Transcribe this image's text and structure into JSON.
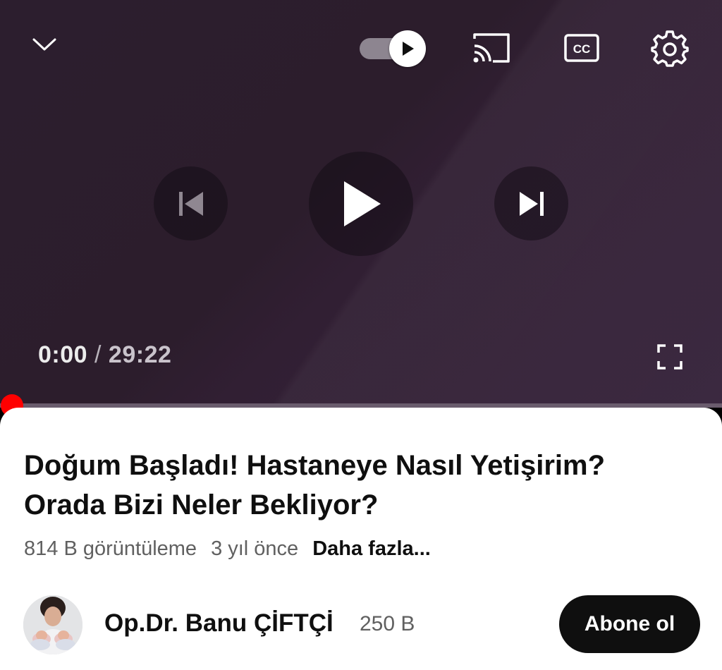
{
  "player": {
    "icons": {
      "collapse": "chevron-down-icon",
      "autoplay": "autoplay-toggle-icon",
      "cast": "cast-icon",
      "captions": "closed-captions-icon",
      "settings": "gear-icon",
      "previous": "skip-previous-icon",
      "play": "play-icon",
      "next": "skip-next-icon",
      "fullscreen": "fullscreen-icon"
    },
    "current_time": "0:00",
    "separator": "/",
    "duration": "29:22",
    "cc_label": "CC",
    "progress": 0,
    "autoplay_on": true,
    "colors": {
      "background": "#2c1e2e",
      "progress_track": "#6a5c6d",
      "scrubber": "#ff0000"
    }
  },
  "video": {
    "title": "Doğum Başladı! Hastaneye Nasıl Yetişirim? Orada Bizi Neler Bekliyor?",
    "views": "814 B görüntüleme",
    "age": "3 yıl önce",
    "more_label": "Daha fazla..."
  },
  "channel": {
    "name": "Op.Dr. Banu ÇİFTÇİ",
    "subscribers": "250 B",
    "subscribe_label": "Abone ol",
    "avatar": "channel-avatar-photo"
  }
}
